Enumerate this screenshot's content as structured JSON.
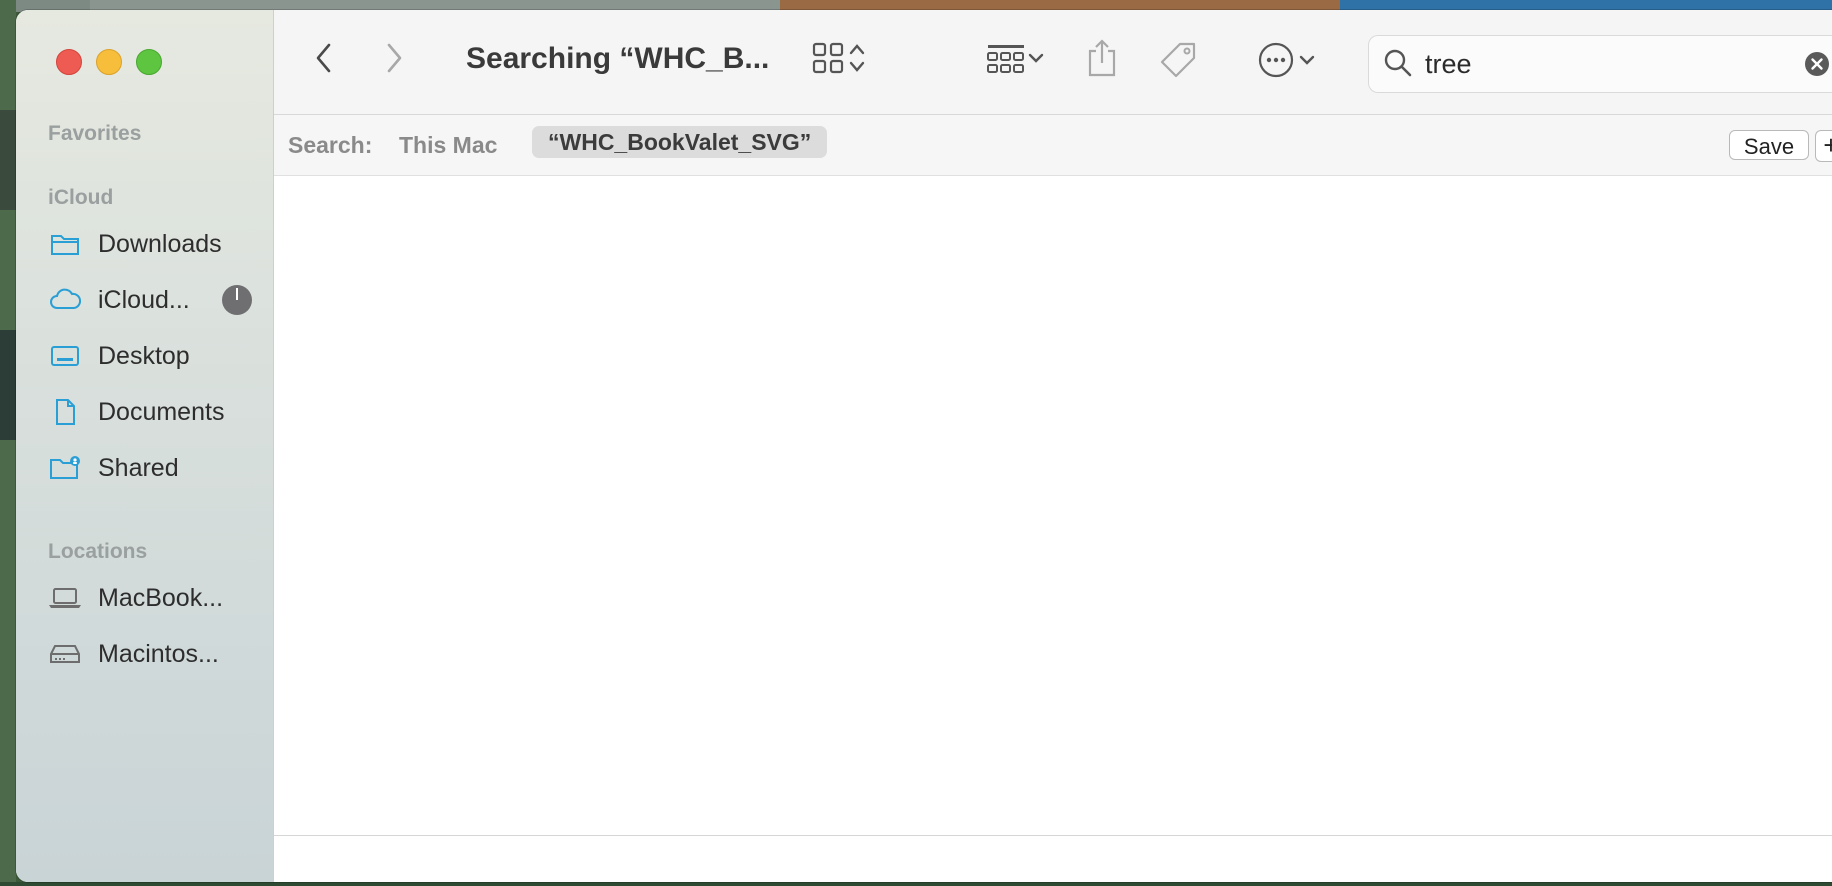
{
  "window": {
    "title": "Searching “WHC_B..."
  },
  "sidebar": {
    "favorites_heading": "Favorites",
    "icloud_heading": "iCloud",
    "icloud_items": [
      {
        "label": "Downloads",
        "icon": "folder-icon"
      },
      {
        "label": "iCloud...",
        "icon": "cloud-icon"
      },
      {
        "label": "Desktop",
        "icon": "desktop-icon"
      },
      {
        "label": "Documents",
        "icon": "document-icon"
      },
      {
        "label": "Shared",
        "icon": "shared-folder-icon"
      }
    ],
    "locations_heading": "Locations",
    "location_items": [
      {
        "label": "MacBook...",
        "icon": "laptop-icon"
      },
      {
        "label": "Macintos...",
        "icon": "hard-drive-icon"
      }
    ]
  },
  "toolbar": {
    "icons": [
      "back-icon",
      "forward-icon",
      "icon-view-icon",
      "group-icon",
      "share-icon",
      "tag-icon",
      "more-actions-icon"
    ]
  },
  "search": {
    "value": "tree"
  },
  "scope": {
    "label": "Search:",
    "this_mac": "This Mac",
    "selected_folder": "“WHC_BookValet_SVG”",
    "save_label": "Save",
    "add_label": "+"
  },
  "colors": {
    "close": "#ee5b52",
    "minimize": "#f6be3b",
    "maximize": "#5ec541",
    "sidebar_icon": "#2a9fd6"
  }
}
